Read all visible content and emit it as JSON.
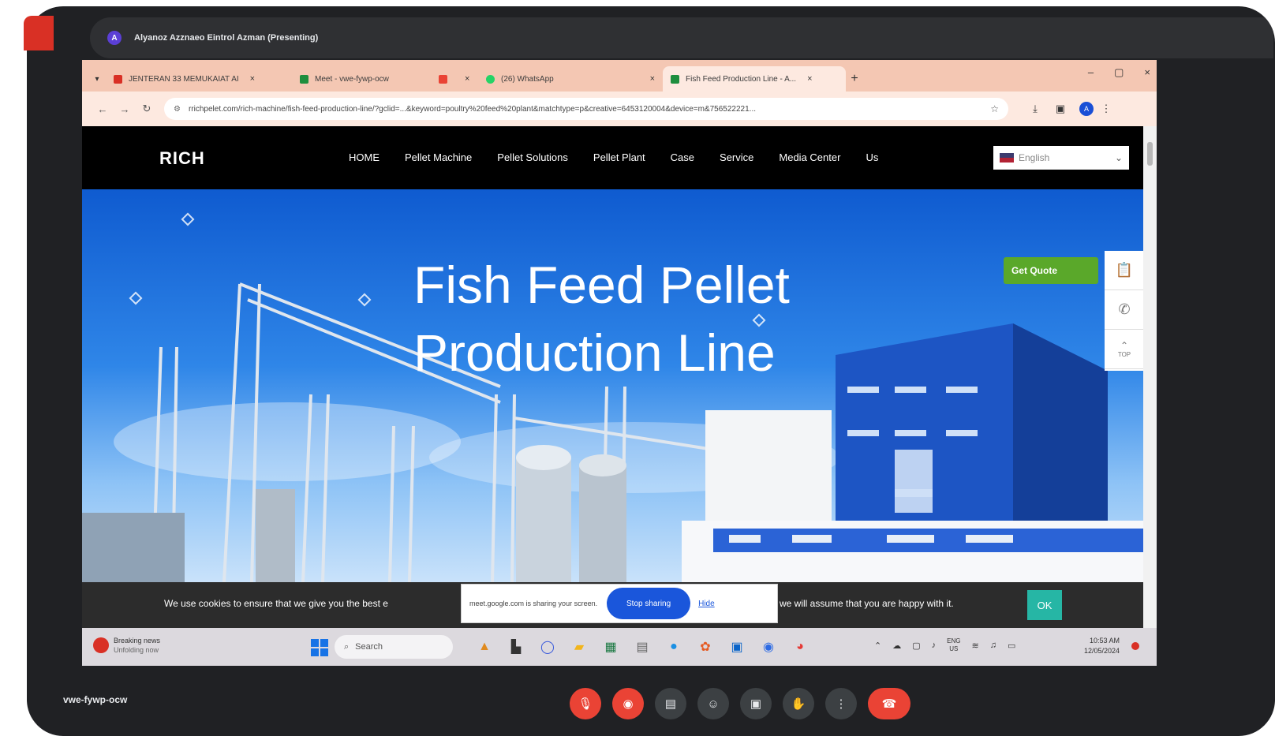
{
  "meet": {
    "presenter_avatar": "A",
    "presenter_text": "Alyanoz Azznaeo Eintrol Azman (Presenting)",
    "meeting_code": "vwe-fywp-ocw",
    "controls": [
      "mic-off-icon",
      "camera-off-icon",
      "captions-icon",
      "emoji-icon",
      "present-icon",
      "raise-hand-icon",
      "more-icon",
      "end-call-icon"
    ]
  },
  "browser": {
    "tabs": [
      {
        "label": "JENTERAN 33 MEMUKAIAT AI",
        "color": "#d93025",
        "close": "×"
      },
      {
        "label": "Meet - vwe-fywp-ocw",
        "color": "#1e8e3e",
        "close": ""
      },
      {
        "label": "",
        "color": "#ea4335",
        "close": "×"
      },
      {
        "label": "(26) WhatsApp",
        "color": "#25d366",
        "close": "×"
      },
      {
        "label": "Fish Feed Production Line - A...",
        "color": "#1e8e3e",
        "close": "×",
        "active": true
      }
    ],
    "new_tab": "+",
    "tab_list": "▾",
    "window_controls": [
      "–",
      "▢",
      "×"
    ],
    "url": "rrichpelet.com/rich-machine/fish-feed-production-line/?gclid=...&keyword=poultry%20feed%20plant&matchtype=p&creative=6453120004&device=m&756522221...",
    "nav_back": "←",
    "nav_forward": "→",
    "nav_reload": "↻"
  },
  "site": {
    "logo": "RICH",
    "menu": [
      "HOME",
      "Pellet Machine",
      "Pellet Solutions",
      "Pellet Plant",
      "Case",
      "Service",
      "Media Center",
      "Us"
    ],
    "language": "English",
    "hero_title_line1": "Fish Feed Pellet",
    "hero_title_line2": "Production Line",
    "cta": "Get Quote",
    "side_tools": [
      "clipboard-icon",
      "whatsapp-icon",
      "top-icon"
    ],
    "top_label": "TOP"
  },
  "cookie": {
    "text_left": "We use cookies to ensure that we give you the best e",
    "text_right": "we will assume that you are happy with it.",
    "ok": "OK"
  },
  "share_bar": {
    "text": "meet.google.com is sharing your screen.",
    "stop": "Stop sharing",
    "hide": "Hide"
  },
  "taskbar": {
    "news_title": "Breaking news",
    "news_sub": "Unfolding now",
    "search_placeholder": "Search",
    "tray_lang_1": "ENG",
    "tray_lang_2": "US",
    "time": "10:53 AM",
    "date": "12/05/2024"
  }
}
